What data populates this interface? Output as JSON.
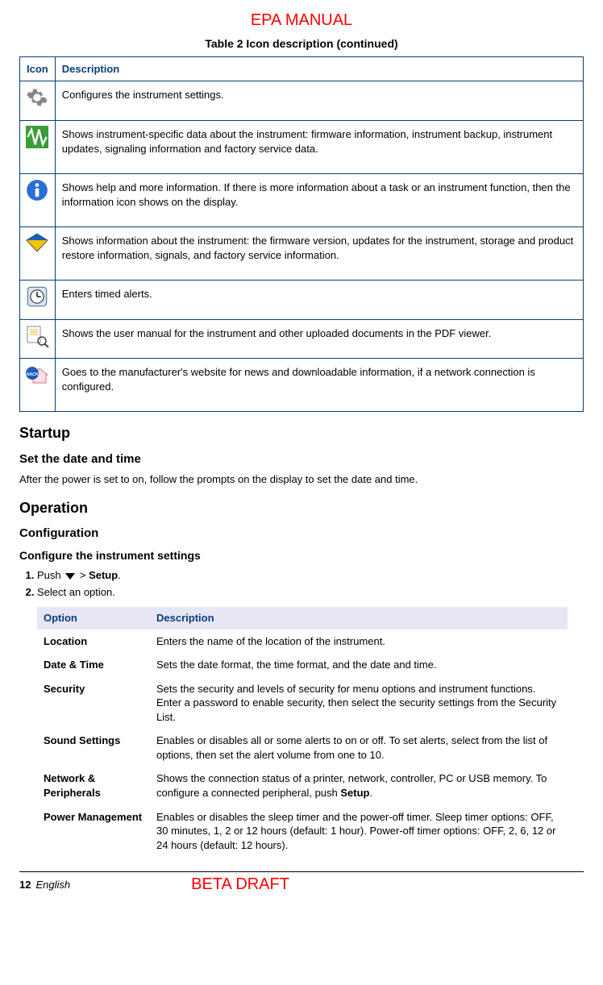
{
  "watermark_top": "EPA MANUAL",
  "table_caption": "Table 2  Icon description (continued)",
  "icon_table": {
    "headers": [
      "Icon",
      "Description"
    ],
    "rows": [
      {
        "icon_name": "gear-icon",
        "desc": "Configures the instrument settings."
      },
      {
        "icon_name": "waveform-icon",
        "desc": "Shows instrument-specific data about the instrument: firmware information, instrument backup, instrument updates, signaling information and factory service data."
      },
      {
        "icon_name": "info-icon",
        "desc": "Shows help and more information. If there is more information about a task or an instrument function, then the information icon shows on the display."
      },
      {
        "icon_name": "diamond-icon",
        "desc": "Shows information about the instrument: the firmware version, updates for the instrument, storage and product restore information, signals, and factory service information."
      },
      {
        "icon_name": "clock-icon",
        "desc": "Enters timed alerts."
      },
      {
        "icon_name": "manual-icon",
        "desc": "Shows the user manual for the instrument and other uploaded documents in the PDF viewer."
      },
      {
        "icon_name": "home-web-icon",
        "desc": "Goes to the manufacturer's website for news and downloadable information, if a network connection is configured."
      }
    ]
  },
  "startup": {
    "heading": "Startup",
    "sub": "Set the date and time",
    "text": "After the power is set to on, follow the prompts on the display to set the date and time."
  },
  "operation": {
    "heading": "Operation",
    "config_heading": "Configuration",
    "config_sub": "Configure the instrument settings",
    "step1_pre": "Push ",
    "step1_post": " > ",
    "step1_setup": "Setup",
    "step1_end": ".",
    "step2": "Select an option.",
    "opt_headers": [
      "Option",
      "Description"
    ],
    "options": [
      {
        "name": "Location",
        "desc": "Enters the name of the location of the instrument."
      },
      {
        "name": "Date & Time",
        "desc": "Sets the date format, the time format, and the date and time."
      },
      {
        "name": "Security",
        "desc": "Sets the security and levels of security for menu options and instrument functions. Enter a password to enable security, then select the security settings from the Security List."
      },
      {
        "name": "Sound Settings",
        "desc": "Enables or disables all or some alerts to on or off. To set alerts, select from the list of options, then set the alert volume from one to 10."
      },
      {
        "name": "Network & Peripherals",
        "desc_pre": "Shows the connection status of a printer, network, controller, PC or USB memory. To configure a connected peripheral, push ",
        "desc_bold": "Setup",
        "desc_post": "."
      },
      {
        "name": "Power Management",
        "desc": "Enables or disables the sleep timer and the power-off timer. Sleep timer options: OFF, 30 minutes, 1, 2 or 12 hours (default: 1 hour). Power-off timer options: OFF, 2, 6, 12 or 24 hours (default: 12 hours)."
      }
    ]
  },
  "footer": {
    "page": "12",
    "lang": "English",
    "draft": "BETA DRAFT"
  }
}
